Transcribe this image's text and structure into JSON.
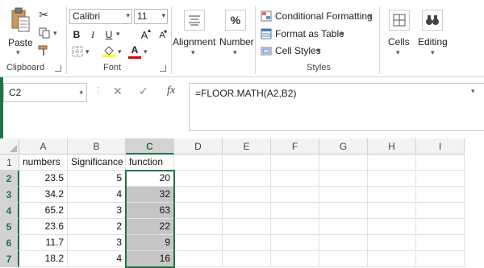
{
  "clipboard": {
    "paste_label": "Paste",
    "group_label": "Clipboard"
  },
  "font": {
    "name": "Calibri",
    "size": "11",
    "bold": "B",
    "italic": "I",
    "underline": "U",
    "grow": "A",
    "shrink": "A",
    "font_color_glyph": "A",
    "group_label": "Font"
  },
  "alignment": {
    "label": "Alignment"
  },
  "number": {
    "label": "Number",
    "icon_glyph": "%"
  },
  "styles": {
    "conditional_formatting": "Conditional Formatting",
    "format_as_table": "Format as Table",
    "cell_styles": "Cell Styles",
    "group_label": "Styles"
  },
  "cells": {
    "label": "Cells"
  },
  "editing": {
    "label": "Editing"
  },
  "formula_bar": {
    "name_box": "C2",
    "cancel_glyph": "✕",
    "enter_glyph": "✓",
    "fx_glyph": "fx",
    "formula": "=FLOOR.MATH(A2,B2)"
  },
  "grid": {
    "columns": [
      "A",
      "B",
      "C",
      "D",
      "E",
      "F",
      "G",
      "H",
      "I"
    ],
    "selected_column": "C",
    "rows": [
      "1",
      "2",
      "3",
      "4",
      "5",
      "6",
      "7"
    ],
    "header_row": [
      "numbers",
      "Significance",
      "function"
    ],
    "data": [
      [
        "23.5",
        "5",
        "20"
      ],
      [
        "34.2",
        "4",
        "32"
      ],
      [
        "65.2",
        "3",
        "63"
      ],
      [
        "23.6",
        "2",
        "22"
      ],
      [
        "11.7",
        "3",
        "9"
      ],
      [
        "18.2",
        "4",
        "16"
      ]
    ]
  },
  "colors": {
    "excel_green": "#217346",
    "selection_fill": "#c6c6c6",
    "font_color_bar": "#e00000",
    "fill_color_bar": "#ffff00"
  }
}
